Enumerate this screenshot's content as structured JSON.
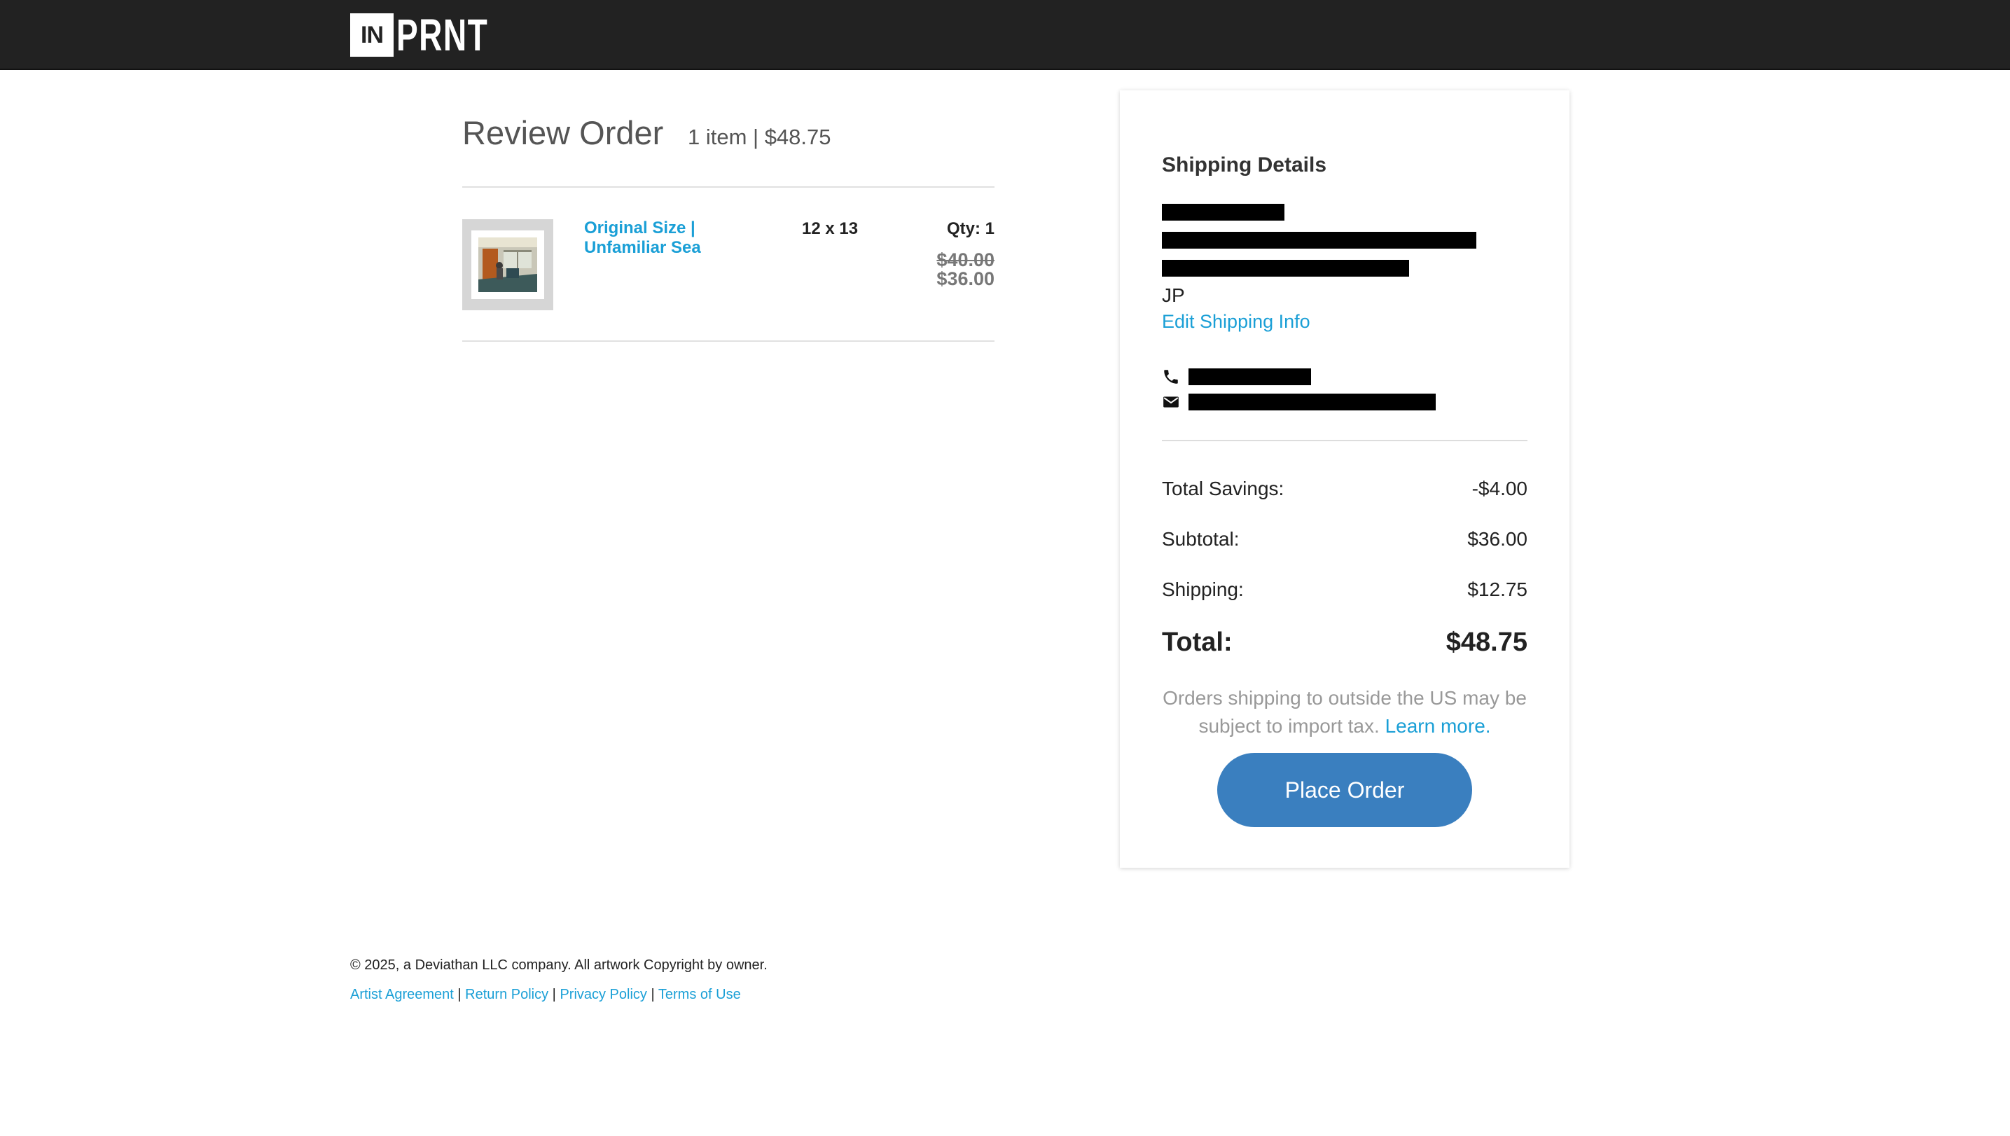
{
  "header": {
    "logo_box": "IN",
    "logo_word": "PRNT"
  },
  "review": {
    "title": "Review Order",
    "summary": "1 item | $48.75"
  },
  "item": {
    "name_line1": "Original Size |",
    "name_line2": "Unfamiliar Sea",
    "size": "12 x 13",
    "qty": "Qty: 1",
    "original_price": "$40.00",
    "price": "$36.00"
  },
  "shipping": {
    "title": "Shipping Details",
    "country": "JP",
    "edit_link": "Edit Shipping Info",
    "phone_icon": "phone-icon",
    "email_icon": "envelope-icon"
  },
  "totals": {
    "savings_label": "Total Savings:",
    "savings_value": "-$4.00",
    "subtotal_label": "Subtotal:",
    "subtotal_value": "$36.00",
    "shipping_label": "Shipping:",
    "shipping_value": "$12.75",
    "total_label": "Total:",
    "total_value": "$48.75"
  },
  "import_note": {
    "text": "Orders shipping to outside the US may be subject to import tax.",
    "link": "Learn more."
  },
  "place_order_label": "Place Order",
  "footer": {
    "copyright": "© 2025, a Deviathan LLC company. All artwork Copyright by owner.",
    "links": [
      "Artist Agreement",
      "Return Policy",
      "Privacy Policy",
      "Terms of Use"
    ],
    "separator": "|"
  },
  "colors": {
    "topbar": "#222222",
    "link": "#1a9fd6",
    "button": "#3a7fbf"
  }
}
